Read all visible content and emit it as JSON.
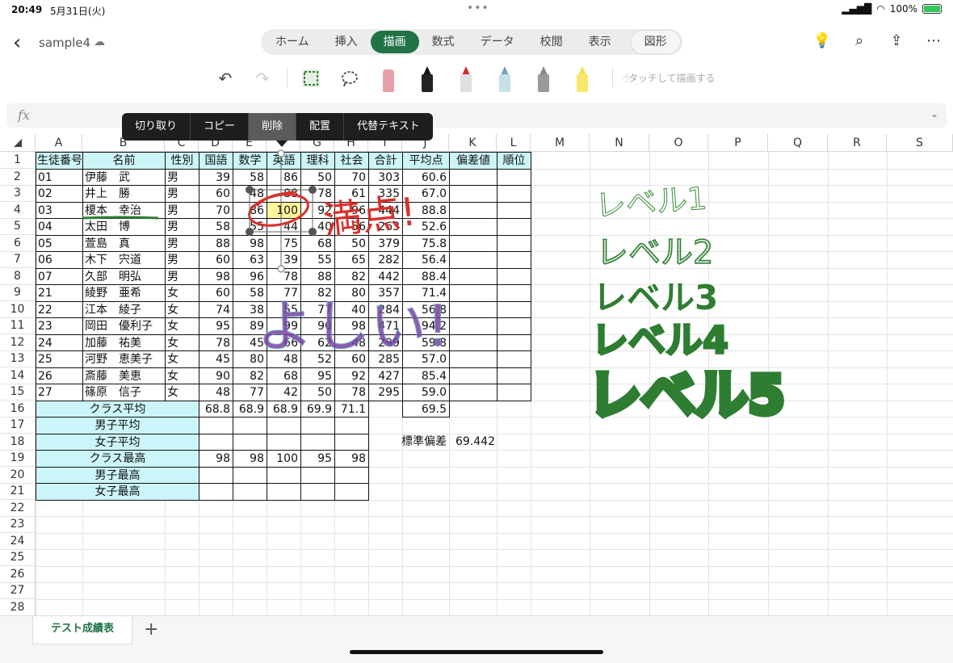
{
  "status": {
    "time": "20:49",
    "date": "5月31日(火)",
    "battery": "100%"
  },
  "file": {
    "name": "sample4"
  },
  "ribbon_tabs": [
    "ホーム",
    "挿入",
    "描画",
    "数式",
    "データ",
    "校閲",
    "表示",
    "図形"
  ],
  "active_tab": "描画",
  "draw": {
    "touch_label": "タッチして描画する"
  },
  "formula": {
    "fx": "fx",
    "value": ""
  },
  "context_menu": [
    "切り取り",
    "コピー",
    "削除",
    "配置",
    "代替テキスト"
  ],
  "context_menu_selected": "削除",
  "columns": [
    "A",
    "B",
    "C",
    "D",
    "E",
    "F",
    "G",
    "H",
    "I",
    "J",
    "K",
    "L",
    "M",
    "N",
    "O",
    "P",
    "Q",
    "R",
    "S"
  ],
  "rows": [
    "1",
    "2",
    "3",
    "4",
    "5",
    "6",
    "7",
    "8",
    "9",
    "10",
    "11",
    "12",
    "13",
    "14",
    "15",
    "16",
    "17",
    "18",
    "19",
    "20",
    "21",
    "22",
    "23",
    "24",
    "25",
    "26",
    "27",
    "28"
  ],
  "headers": [
    "生徒番号",
    "名前",
    "性別",
    "国語",
    "数学",
    "英語",
    "理科",
    "社会",
    "合計",
    "平均点",
    "偏差値",
    "順位"
  ],
  "students": [
    [
      "01",
      "伊藤　武",
      "男",
      "39",
      "58",
      "86",
      "50",
      "70",
      "303",
      "60.6"
    ],
    [
      "02",
      "井上　勝",
      "男",
      "60",
      "48",
      "88",
      "78",
      "61",
      "335",
      "67.0"
    ],
    [
      "03",
      "榎本　幸治",
      "男",
      "70",
      "86",
      "100",
      "92",
      "96",
      "444",
      "88.8"
    ],
    [
      "04",
      "太田　博",
      "男",
      "58",
      "55",
      "44",
      "40",
      "56",
      "263",
      "52.6"
    ],
    [
      "05",
      "萱島　真",
      "男",
      "88",
      "98",
      "75",
      "68",
      "50",
      "379",
      "75.8"
    ],
    [
      "06",
      "木下　宍道",
      "男",
      "60",
      "63",
      "39",
      "55",
      "65",
      "282",
      "56.4"
    ],
    [
      "07",
      "久部　明弘",
      "男",
      "98",
      "96",
      "78",
      "88",
      "82",
      "442",
      "88.4"
    ],
    [
      "21",
      "綾野　亜希",
      "女",
      "60",
      "58",
      "77",
      "82",
      "80",
      "357",
      "71.4"
    ],
    [
      "22",
      "江本　綾子",
      "女",
      "74",
      "38",
      "55",
      "77",
      "40",
      "284",
      "56.8"
    ],
    [
      "23",
      "岡田　優利子",
      "女",
      "95",
      "89",
      "99",
      "90",
      "98",
      "471",
      "94.2"
    ],
    [
      "24",
      "加藤　祐美",
      "女",
      "78",
      "45",
      "66",
      "62",
      "48",
      "299",
      "59.8"
    ],
    [
      "25",
      "河野　恵美子",
      "女",
      "45",
      "80",
      "48",
      "52",
      "60",
      "285",
      "57.0"
    ],
    [
      "26",
      "斎藤　美恵",
      "女",
      "90",
      "82",
      "68",
      "95",
      "92",
      "427",
      "85.4"
    ],
    [
      "27",
      "篠原　信子",
      "女",
      "48",
      "77",
      "42",
      "50",
      "78",
      "295",
      "59.0"
    ]
  ],
  "summary": [
    {
      "label": "クラス平均",
      "values": [
        "68.8",
        "68.9",
        "68.9",
        "69.9",
        "71.1"
      ],
      "avg": "69.5"
    },
    {
      "label": "男子平均",
      "values": [
        "",
        "",
        "",
        "",
        ""
      ],
      "avg": ""
    },
    {
      "label": "女子平均",
      "values": [
        "",
        "",
        "",
        "",
        ""
      ],
      "avg": ""
    },
    {
      "label": "クラス最高",
      "values": [
        "98",
        "98",
        "100",
        "95",
        "98"
      ],
      "avg": ""
    },
    {
      "label": "男子最高",
      "values": [
        "",
        "",
        "",
        "",
        ""
      ],
      "avg": ""
    },
    {
      "label": "女子最高",
      "values": [
        "",
        "",
        "",
        "",
        ""
      ],
      "avg": ""
    }
  ],
  "std_dev": {
    "label": "標準偏差",
    "value": "69.442"
  },
  "ink": {
    "manten": "満点!",
    "yoshii": "よしい!",
    "levels": [
      "レベル1",
      "レベル2",
      "レベル3",
      "レベル4",
      "レベル5"
    ],
    "colors": {
      "red": "#d9302a",
      "green": "#2e7d32",
      "purple": "#7b3fa0"
    }
  },
  "sheet": {
    "tab": "テスト成績表",
    "add": "+"
  }
}
